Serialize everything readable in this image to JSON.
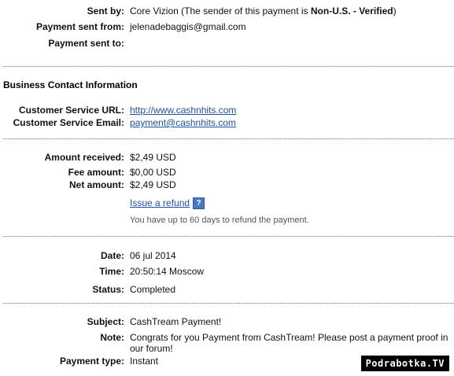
{
  "sender": {
    "sent_by_label": "Sent by:",
    "sent_by_name": "Core Vizion",
    "sent_by_note_prefix": " (The sender of this payment is ",
    "sent_by_status": "Non-U.S. - Verified",
    "sent_by_note_suffix": ")",
    "sent_from_label": "Payment sent from:",
    "sent_from_value": "jelenadebaggis@gmail.com",
    "sent_to_label": "Payment sent to:",
    "sent_to_value": ""
  },
  "business": {
    "title": "Business Contact Information",
    "url_label": "Customer Service URL:",
    "url_value": "http://www.cashnhits.com",
    "email_label": "Customer Service Email:",
    "email_value": "payment@cashnhits.com"
  },
  "amounts": {
    "received_label": "Amount received:",
    "received_value": "$2,49 USD",
    "fee_label": "Fee amount:",
    "fee_value": "$0,00 USD",
    "net_label": "Net amount:",
    "net_value": "$2,49 USD",
    "refund_link": "Issue a refund",
    "help_icon": "?",
    "refund_note": "You have up to 60 days to refund the payment."
  },
  "details": {
    "date_label": "Date:",
    "date_value": "06 jul 2014",
    "time_label": "Time:",
    "time_value": "20:50:14 Moscow",
    "status_label": "Status:",
    "status_value": "Completed"
  },
  "message": {
    "subject_label": "Subject:",
    "subject_value": "CashTream Payment!",
    "note_label": "Note:",
    "note_value": "Congrats for you Payment from CashTream! Please post a payment proof in our forum!",
    "type_label": "Payment type:",
    "type_value": "Instant"
  },
  "watermark": "Podrabotka.TV",
  "colors": {
    "link": "#1f4f9c",
    "help_icon_bg": "#4a78c6",
    "separator": "#6a6a6a"
  }
}
